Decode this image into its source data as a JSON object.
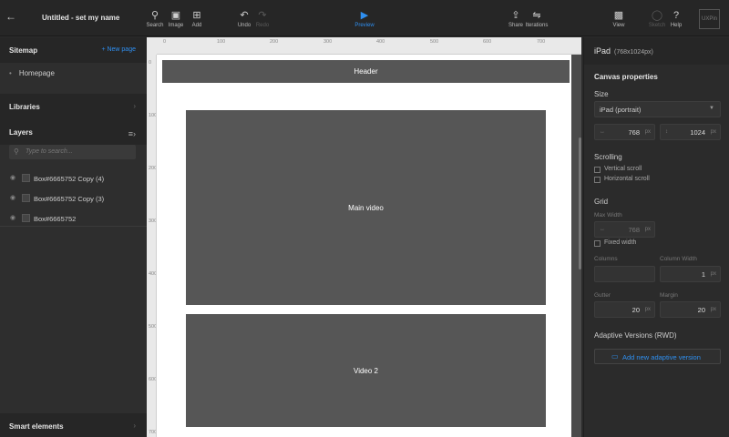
{
  "topbar": {
    "title": "Untitled - set my name",
    "tools": {
      "search": "Search",
      "image": "Image",
      "add": "Add",
      "undo": "Undo",
      "redo": "Redo",
      "preview": "Preview",
      "share": "Share",
      "iterations": "Iterations",
      "view": "View",
      "sketch": "Sketch",
      "help": "Help"
    },
    "logo": "UXPin"
  },
  "sitemap": {
    "title": "Sitemap",
    "new_page": "+ New page",
    "pages": [
      "Homepage"
    ]
  },
  "libraries": {
    "title": "Libraries"
  },
  "layers": {
    "title": "Layers",
    "search_placeholder": "Type to search...",
    "items": [
      "Box#6665752 Copy (4)",
      "Box#6665752 Copy (3)",
      "Box#6665752"
    ]
  },
  "smart_elements": {
    "title": "Smart elements"
  },
  "ruler": {
    "top": [
      "0",
      "100",
      "200",
      "300",
      "400",
      "500",
      "600",
      "700"
    ],
    "left": [
      "0",
      "100",
      "200",
      "300",
      "400",
      "500",
      "600",
      "700"
    ]
  },
  "canvas": {
    "header": "Header",
    "main_video": "Main video",
    "video2": "Video 2"
  },
  "properties": {
    "device": "iPad",
    "device_size": "(768x1024px)",
    "canvas_title": "Canvas properties",
    "size_label": "Size",
    "size_value": "iPad (portrait)",
    "width": "768",
    "height": "1024",
    "unit": "px",
    "scrolling_label": "Scrolling",
    "vertical_scroll": "Vertical scroll",
    "horizontal_scroll": "Horizontal scroll",
    "grid_label": "Grid",
    "max_width_label": "Max Width",
    "max_width": "768",
    "fixed_width": "Fixed width",
    "columns_label": "Columns",
    "column_width_label": "Column Width",
    "column_width": "1",
    "gutter_label": "Gutter",
    "gutter": "20",
    "margin_label": "Margin",
    "margin": "20",
    "adaptive_title": "Adaptive Versions (RWD)",
    "add_adaptive": "Add new adaptive version"
  },
  "colors": {
    "accent": "#2f8ff0",
    "block": "#565656"
  }
}
